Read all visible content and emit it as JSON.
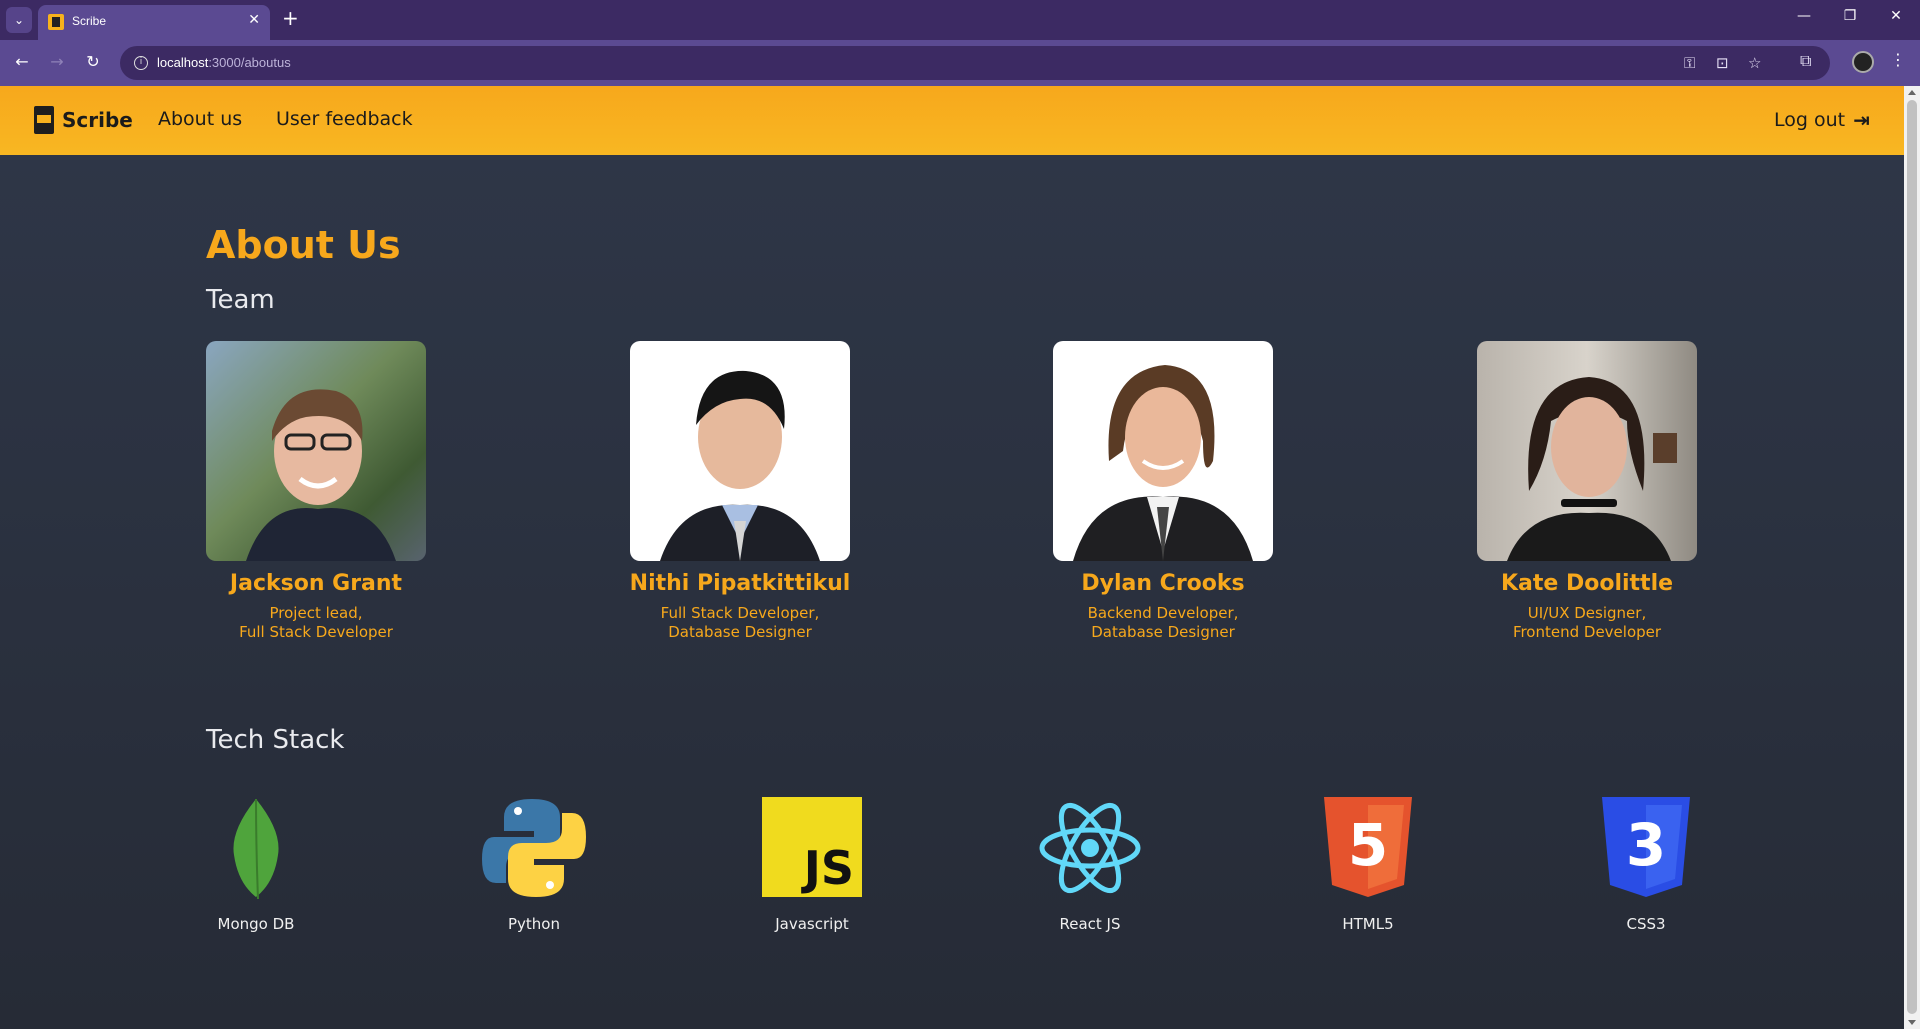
{
  "browser": {
    "tab_title": "Scribe",
    "tab_close": "✕",
    "new_tab": "+",
    "url_host": "localhost",
    "url_path": ":3000/aboutus",
    "minimize": "—",
    "restore": "❐",
    "close": "✕"
  },
  "nav": {
    "brand": "Scribe",
    "links": [
      "About us",
      "User feedback"
    ],
    "logout": "Log out"
  },
  "page": {
    "title": "About Us",
    "team_heading": "Team",
    "team": [
      {
        "name": "Jackson Grant",
        "role_line1": "Project lead,",
        "role_line2": "Full Stack Developer"
      },
      {
        "name": "Nithi Pipatkittikul",
        "role_line1": "Full Stack Developer,",
        "role_line2": "Database Designer"
      },
      {
        "name": "Dylan Crooks",
        "role_line1": "Backend Developer,",
        "role_line2": "Database Designer"
      },
      {
        "name": "Kate Doolittle",
        "role_line1": "UI/UX Designer,",
        "role_line2": "Frontend Developer"
      }
    ],
    "tech_heading": "Tech Stack",
    "tech": [
      {
        "label": "Mongo DB",
        "icon": "mongodb-icon"
      },
      {
        "label": "Python",
        "icon": "python-icon"
      },
      {
        "label": "Javascript",
        "icon": "javascript-icon",
        "glyph": "JS"
      },
      {
        "label": "React JS",
        "icon": "react-icon"
      },
      {
        "label": "HTML5",
        "icon": "html5-icon",
        "glyph": "5"
      },
      {
        "label": "CSS3",
        "icon": "css3-icon",
        "glyph": "3"
      }
    ]
  },
  "colors": {
    "accent": "#f7a81c",
    "background": "#2d3445",
    "browser_frame": "#3c2a63"
  }
}
